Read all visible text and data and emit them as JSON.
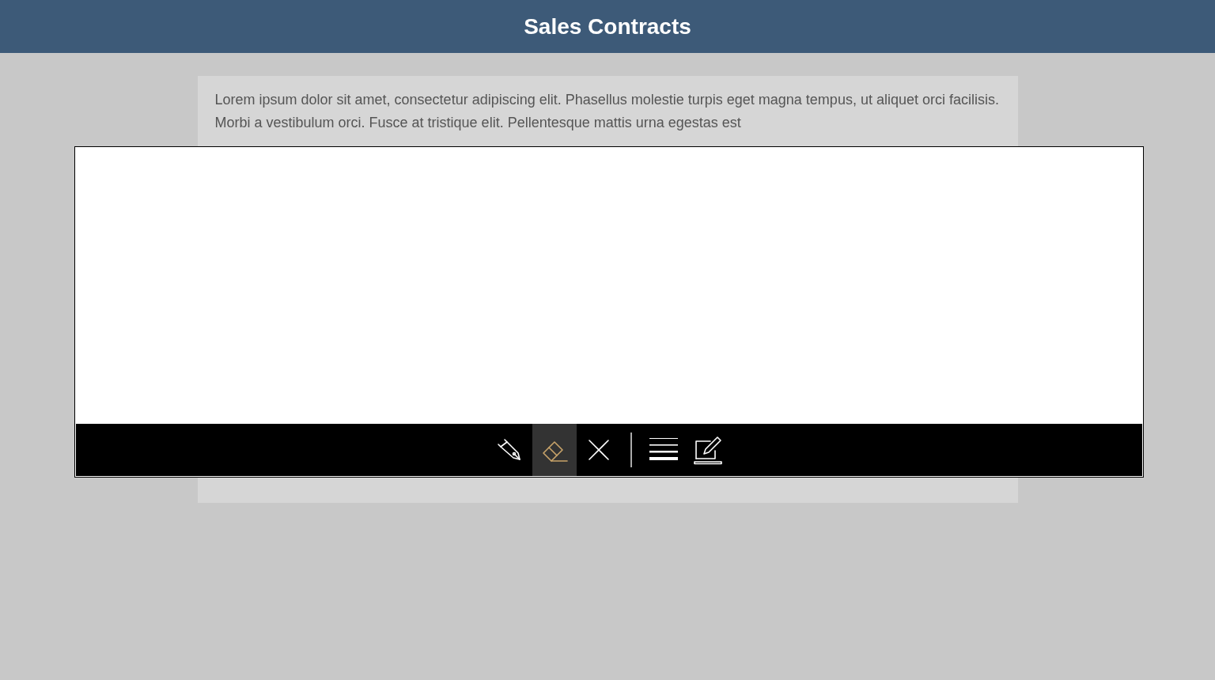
{
  "header": {
    "title": "Sales Contracts"
  },
  "content": {
    "text": "Lorem ipsum dolor sit amet, consectetur adipiscing elit. Phasellus molestie turpis eget magna tempus, ut aliquet orci facilisis. Morbi a vestibulum orci. Fusce at tristique elit. Pellentesque mattis urna egestas est"
  },
  "pen_input": {
    "tool_groups": [
      [
        {
          "kind": "pen",
          "selected": false
        },
        {
          "kind": "eraser",
          "selected": true
        },
        {
          "kind": "clear",
          "selected": false
        }
      ],
      [
        {
          "kind": "thickness",
          "selected": false
        },
        {
          "kind": "edit",
          "selected": false
        }
      ]
    ]
  }
}
